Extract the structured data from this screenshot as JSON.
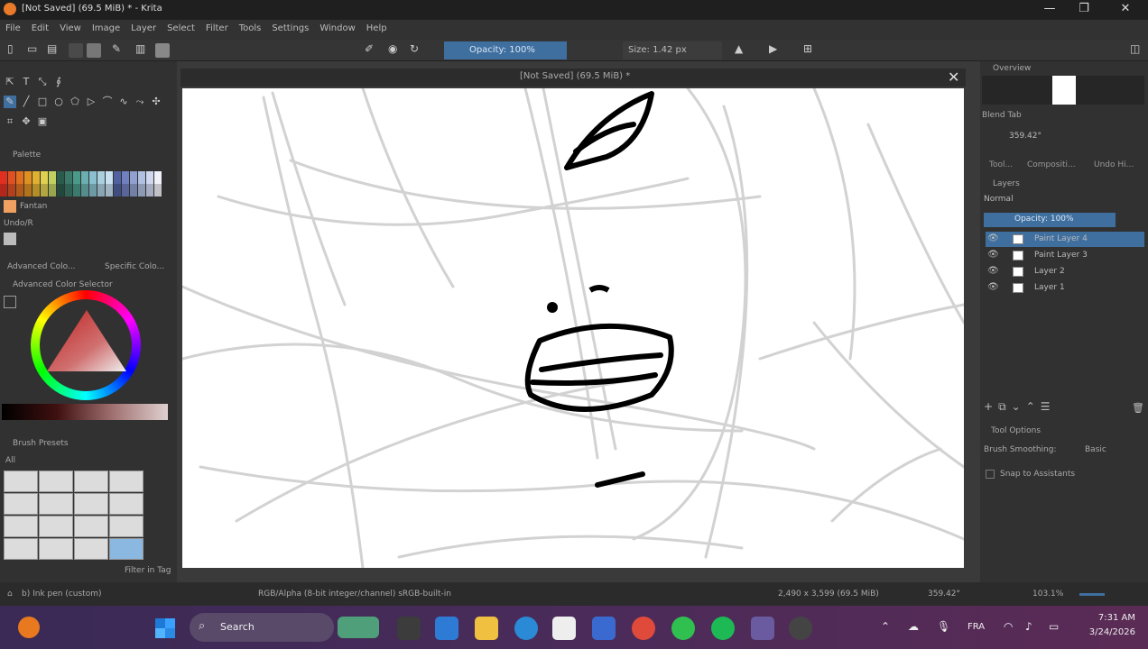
{
  "window": {
    "title": "[Not Saved] (69.5 MiB) * - Krita",
    "minimize": "—",
    "maximize": "❐",
    "close": "✕"
  },
  "menu": [
    "File",
    "Edit",
    "View",
    "Image",
    "Layer",
    "Select",
    "Filter",
    "Tools",
    "Settings",
    "Window",
    "Help"
  ],
  "toolbar": {
    "opacity_label": "Opacity: 100%",
    "size_label": "Size: 1.42 px"
  },
  "left": {
    "palette_title": "Palette",
    "palette_swatch_name": "Fantan",
    "history_title": "Undo/R",
    "tabs": [
      "Advanced Colo...",
      "Specific Colo..."
    ],
    "color_selector_title": "Advanced Color Selector",
    "brush_presets_title": "Brush Presets",
    "filter_label": "All",
    "filter_in_tag": "Filter in Tag"
  },
  "doc": {
    "tab_title": "[Not Saved] (69.5 MiB) *",
    "close": "✕"
  },
  "right": {
    "overview_title": "Overview",
    "blend_title": "Blend Tab",
    "angle_value": "359.42°",
    "tabs": [
      "Tool...",
      "Compositi...",
      "Undo Hi..."
    ],
    "layers_title": "Layers",
    "blend_mode": "Normal",
    "layer_opacity": "Opacity: 100%",
    "layers": [
      {
        "name": "Paint Layer 4",
        "selected": true
      },
      {
        "name": "Paint Layer 3",
        "selected": false
      },
      {
        "name": "Layer 2",
        "selected": false
      },
      {
        "name": "Layer 1",
        "selected": false
      }
    ],
    "tool_options_title": "Tool Options",
    "brush_smoothing_label": "Brush Smoothing:",
    "brush_smoothing_value": "Basic",
    "snap_label": "Snap to Assistants"
  },
  "status": {
    "brush": "b) Ink pen (custom)",
    "color_space": "RGB/Alpha (8-bit integer/channel) sRGB-built-in",
    "dimensions": "2,490 x 3,599 (69.5 MiB)",
    "rotation": "359.42°",
    "zoom": "103.1%"
  },
  "taskbar": {
    "search_label": "Search",
    "lang": "FRA",
    "time": "7:31 AM",
    "date": "3/24/2026"
  },
  "colors": {
    "accent": "#3f6f9f",
    "taskbar": "#4a2b5a"
  }
}
